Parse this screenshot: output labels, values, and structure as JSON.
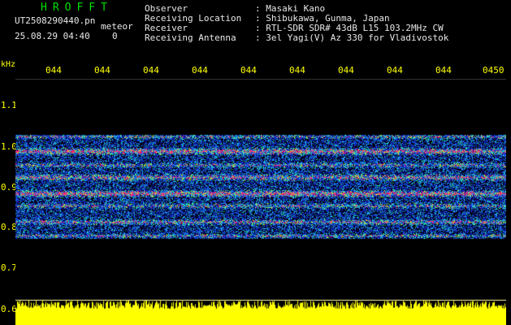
{
  "header": {
    "logo": "HROFFT",
    "filename": "UT2508290440.pn",
    "meteor_label": "meteor",
    "datetime": "25.08.29 04:40",
    "count": "0",
    "info": [
      {
        "key": "Observer",
        "value": ": Masaki Kano"
      },
      {
        "key": "Receiving Location",
        "value": ": Shibukawa, Gunma, Japan"
      },
      {
        "key": "Receiver",
        "value": ": RTL-SDR SDR# 43dB L15 103.2MHz CW"
      },
      {
        "key": "Receiving Antenna",
        "value": ": 3el Yagi(V) Az 330 for Vladivostok"
      }
    ]
  },
  "axes": {
    "y_unit": "kHz",
    "x_ticks": [
      "044",
      "044",
      "044",
      "044",
      "044",
      "044",
      "044",
      "044",
      "044",
      "0450"
    ],
    "y_ticks": [
      "1.1",
      "1.0",
      "0.9",
      "0.8",
      "0.7",
      "0.6"
    ]
  },
  "colors": {
    "label": "#ffff00",
    "logo": "#00e000",
    "text": "#e8e8e8",
    "noise_floor": "#000000",
    "noise_base": "#0a1a8c",
    "strong_band": "#ff3070",
    "baseline_fill": "#ffff00"
  }
}
